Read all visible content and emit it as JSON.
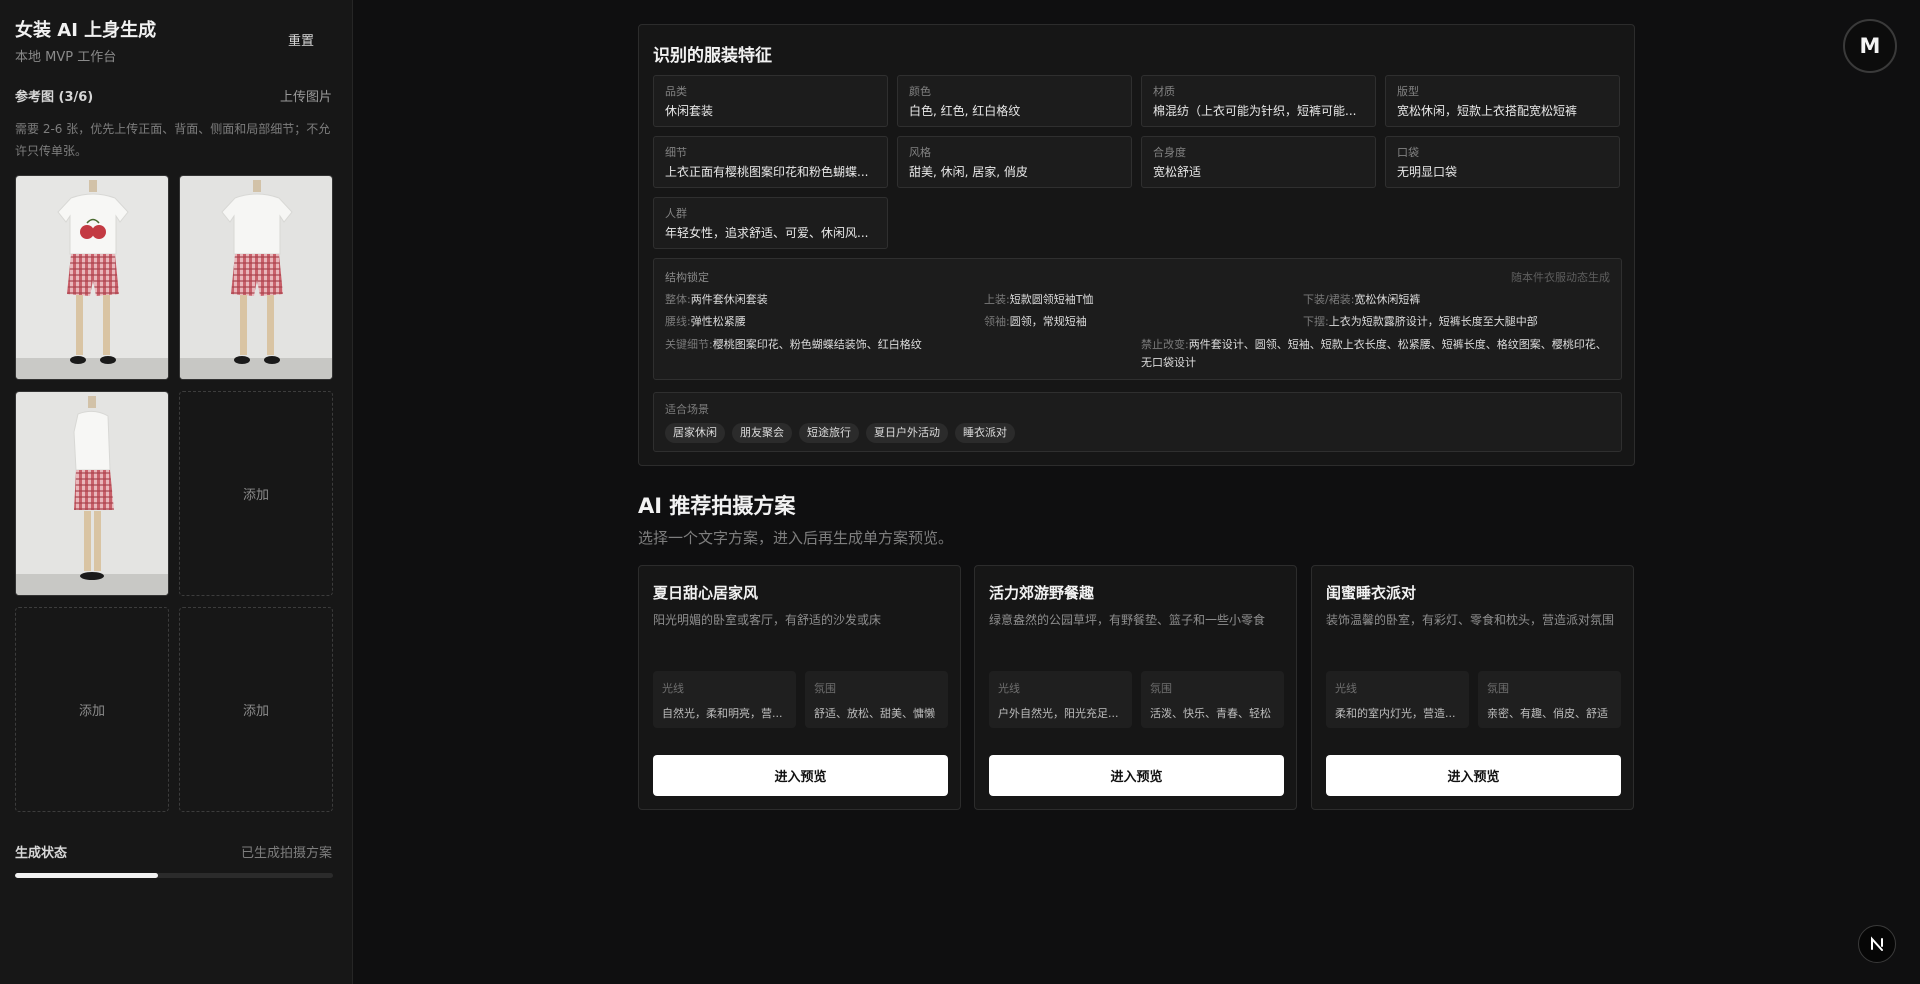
{
  "sidebar": {
    "title": "女装 AI 上身生成",
    "subtitle": "本地 MVP 工作台",
    "reset_label": "重置",
    "ref_title": "参考图 (3/6)",
    "upload_label": "上传图片",
    "hint": "需要 2-6 张，优先上传正面、背面、侧面和局部细节；不允许只传单张。",
    "add_label": "添加",
    "status_title": "生成状态",
    "status_text": "已生成拍摄方案",
    "progress": 0.45
  },
  "features": {
    "title": "识别的服装特征",
    "attrs": [
      {
        "label": "品类",
        "value": "休闲套装"
      },
      {
        "label": "颜色",
        "value": "白色, 红色, 红白格纹"
      },
      {
        "label": "材质",
        "value": "棉混纺（上衣可能为针织，短裤可能..."
      },
      {
        "label": "版型",
        "value": "宽松休闲，短款上衣搭配宽松短裤"
      },
      {
        "label": "细节",
        "value": "上衣正面有樱桃图案印花和粉色蝴蝶..."
      },
      {
        "label": "风格",
        "value": "甜美, 休闲, 居家, 俏皮"
      },
      {
        "label": "合身度",
        "value": "宽松舒适"
      },
      {
        "label": "口袋",
        "value": "无明显口袋"
      },
      {
        "label": "人群",
        "value": "年轻女性，追求舒适、可爱、休闲风..."
      }
    ],
    "structure": {
      "title": "结构锁定",
      "note": "随本件衣服动态生成",
      "whole_k": "整体:",
      "whole_v": "两件套休闲套装",
      "top_k": "上装:",
      "top_v": "短款圆领短袖T恤",
      "bottom_k": "下装/裙装:",
      "bottom_v": "宽松休闲短裤",
      "waist_k": "腰线:",
      "waist_v": "弹性松紧腰",
      "collar_k": "领袖:",
      "collar_v": "圆领，常规短袖",
      "hem_k": "下摆:",
      "hem_v": "上衣为短款露脐设计，短裤长度至大腿中部",
      "details_k": "关键细节:",
      "details_v": "樱桃图案印花、粉色蝴蝶结装饰、红白格纹",
      "forbid_k": "禁止改变:",
      "forbid_v": "两件套设计、圆领、短袖、短款上衣长度、松紧腰、短裤长度、格纹图案、樱桃印花、无口袋设计"
    },
    "scenes": {
      "title": "适合场景",
      "tags": [
        "居家休闲",
        "朋友聚会",
        "短途旅行",
        "夏日户外活动",
        "睡衣派对"
      ]
    }
  },
  "plans": {
    "title": "AI 推荐拍摄方案",
    "subtitle": "选择一个文字方案，进入后再生成单方案预览。",
    "light_label": "光线",
    "mood_label": "氛围",
    "button_label": "进入预览",
    "items": [
      {
        "title": "夏日甜心居家风",
        "desc": "阳光明媚的卧室或客厅，有舒适的沙发或床",
        "light": "自然光，柔和明亮，营...",
        "mood": "舒适、放松、甜美、慵懒"
      },
      {
        "title": "活力郊游野餐趣",
        "desc": "绿意盎然的公园草坪，有野餐垫、篮子和一些小零食",
        "light": "户外自然光，阳光充足...",
        "mood": "活泼、快乐、青春、轻松"
      },
      {
        "title": "闺蜜睡衣派对",
        "desc": "装饰温馨的卧室，有彩灯、零食和枕头，营造派对氛围",
        "light": "柔和的室内灯光，营造...",
        "mood": "亲密、有趣、俏皮、舒适"
      }
    ]
  },
  "user": {
    "avatar_letter": "M"
  },
  "icons": {
    "n_badge": "next-logo-icon"
  }
}
